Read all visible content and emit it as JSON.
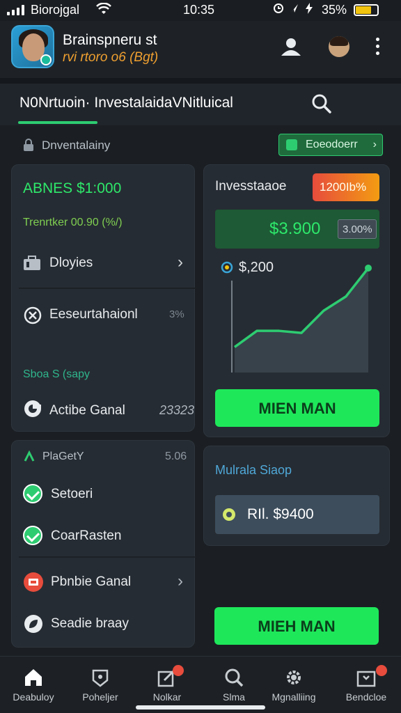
{
  "status_bar": {
    "carrier": "Biorojgal",
    "time": "10:35",
    "battery": "35%"
  },
  "header": {
    "name": "Brainspneru st",
    "subtitle": "rvi rtoro o6 (Bgt)"
  },
  "tabbar": {
    "title": "N0Nrtuoin· InvestalaidaVNitluical"
  },
  "subrow": {
    "label": "Dnventalainy",
    "action_label": "Eoeodoerr"
  },
  "left_top": {
    "heading": "ABNES $1:000",
    "meta": "Trenrtker 00.90 (%/)",
    "item1": "Dloyies",
    "item2": "Eeseurtahaionl",
    "item2_value": "3%",
    "section": "Sboa S (sapy",
    "item3": "Actibe Ganal",
    "item3_value": "23323"
  },
  "left_bottom": {
    "section": "PlaGetY",
    "section_value": "5.06",
    "item1": "Setoeri",
    "item2": "CoarRasten",
    "item3": "Pbnbie Ganal",
    "item4": "Seadie braay"
  },
  "right_top": {
    "title": "Invesstaaoe",
    "badge": "1200Ib%",
    "amount": "$3.900",
    "amount_pill": "3.00%",
    "chart_value": "$,200",
    "cta": "MIEN MAN"
  },
  "chart_data": {
    "type": "line",
    "values": [
      1,
      2.6,
      2.6,
      2.4,
      4.6,
      6.0,
      8.8
    ],
    "title": "",
    "xlabel": "",
    "ylabel": ""
  },
  "right_bottom": {
    "title": "Mulrala Siaop",
    "value": "RIl. $9400"
  },
  "bottom_cta": "MIEH MAN",
  "nav": {
    "items": [
      {
        "label": "Deabuloy"
      },
      {
        "label": "Poheljer"
      },
      {
        "label": "Nolkar"
      },
      {
        "label": "Slma"
      },
      {
        "label": "Mgnalliing"
      },
      {
        "label": "Bendcloe"
      }
    ]
  },
  "colors": {
    "accent": "#2ee86b",
    "badge_red": "#e74c3c",
    "badge_orange": "#f39c12",
    "background": "#1b1f24"
  }
}
